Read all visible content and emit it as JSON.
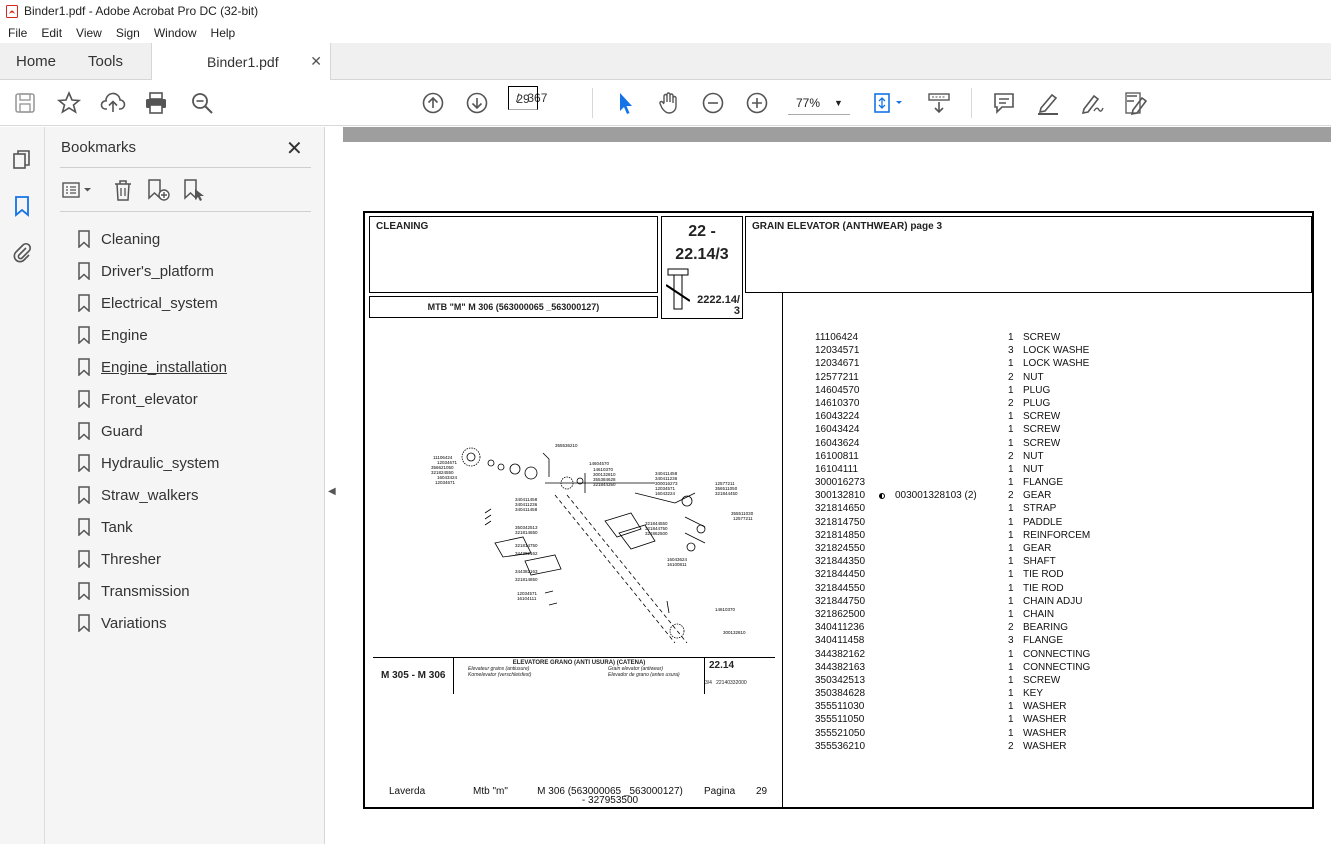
{
  "window": {
    "title": "Binder1.pdf - Adobe Acrobat Pro DC (32-bit)"
  },
  "menu": [
    "File",
    "Edit",
    "View",
    "Sign",
    "Window",
    "Help"
  ],
  "tabs": {
    "home": "Home",
    "tools": "Tools",
    "document": "Binder1.pdf"
  },
  "toolbar": {
    "current_page": "29",
    "page_sep": "/",
    "total_pages": "367",
    "zoom": "77%"
  },
  "bookmarks": {
    "title": "Bookmarks",
    "items": [
      "Cleaning",
      "Driver's_platform",
      "Electrical_system",
      "Engine",
      "Engine_installation",
      "Front_elevator",
      "Guard",
      "Hydraulic_system",
      "Straw_walkers",
      "Tank",
      "Thresher",
      "Transmission",
      "Variations"
    ]
  },
  "page": {
    "section": "CLEANING",
    "code_line1": "22 -",
    "code_line2": "22.14/3",
    "code_small": "2222.14/",
    "code_small2": "3",
    "title": "GRAIN ELEVATOR (ANTHWEAR) page 3",
    "model": "MTB \"M\" M 306 (563000065 _563000127)",
    "parts": [
      {
        "code": "11106424",
        "note": "",
        "qty": "1",
        "desc": "SCREW"
      },
      {
        "code": "12034571",
        "note": "",
        "qty": "3",
        "desc": "LOCK WASHE"
      },
      {
        "code": "12034671",
        "note": "",
        "qty": "1",
        "desc": "LOCK WASHE"
      },
      {
        "code": "12577211",
        "note": "",
        "qty": "2",
        "desc": "NUT"
      },
      {
        "code": "14604570",
        "note": "",
        "qty": "1",
        "desc": "PLUG"
      },
      {
        "code": "14610370",
        "note": "",
        "qty": "2",
        "desc": "PLUG"
      },
      {
        "code": "16043224",
        "note": "",
        "qty": "1",
        "desc": "SCREW"
      },
      {
        "code": "16043424",
        "note": "",
        "qty": "1",
        "desc": "SCREW"
      },
      {
        "code": "16043624",
        "note": "",
        "qty": "1",
        "desc": "SCREW"
      },
      {
        "code": "16100811",
        "note": "",
        "qty": "2",
        "desc": "NUT"
      },
      {
        "code": "16104111",
        "note": "",
        "qty": "1",
        "desc": "NUT"
      },
      {
        "code": "300016273",
        "note": "",
        "qty": "1",
        "desc": "FLANGE"
      },
      {
        "code": "300132810",
        "note": "003001328103  (2)",
        "qty": "2",
        "desc": "GEAR"
      },
      {
        "code": "321814650",
        "note": "",
        "qty": "1",
        "desc": "STRAP"
      },
      {
        "code": "321814750",
        "note": "",
        "qty": "1",
        "desc": "PADDLE"
      },
      {
        "code": "321814850",
        "note": "",
        "qty": "1",
        "desc": "REINFORCEM"
      },
      {
        "code": "321824550",
        "note": "",
        "qty": "1",
        "desc": "GEAR"
      },
      {
        "code": "321844350",
        "note": "",
        "qty": "1",
        "desc": "SHAFT"
      },
      {
        "code": "321844450",
        "note": "",
        "qty": "1",
        "desc": "TIE ROD"
      },
      {
        "code": "321844550",
        "note": "",
        "qty": "1",
        "desc": "TIE ROD"
      },
      {
        "code": "321844750",
        "note": "",
        "qty": "1",
        "desc": "CHAIN ADJU"
      },
      {
        "code": "321862500",
        "note": "",
        "qty": "1",
        "desc": "CHAIN"
      },
      {
        "code": "340411236",
        "note": "",
        "qty": "2",
        "desc": "BEARING"
      },
      {
        "code": "340411458",
        "note": "",
        "qty": "3",
        "desc": "FLANGE"
      },
      {
        "code": "344382162",
        "note": "",
        "qty": "1",
        "desc": "CONNECTING"
      },
      {
        "code": "344382163",
        "note": "",
        "qty": "1",
        "desc": "CONNECTING"
      },
      {
        "code": "350342513",
        "note": "",
        "qty": "1",
        "desc": "SCREW"
      },
      {
        "code": "350384628",
        "note": "",
        "qty": "1",
        "desc": "KEY"
      },
      {
        "code": "355511030",
        "note": "",
        "qty": "1",
        "desc": "WASHER"
      },
      {
        "code": "355511050",
        "note": "",
        "qty": "1",
        "desc": "WASHER"
      },
      {
        "code": "355521050",
        "note": "",
        "qty": "1",
        "desc": "WASHER"
      },
      {
        "code": "355536210",
        "note": "",
        "qty": "2",
        "desc": "WASHER"
      }
    ],
    "legend": {
      "model": "M 305 - M 306",
      "title": "ELEVATORE GRANO (ANTI USURA) (CATENA)",
      "sub1": "Elevateur grains (antiusure)",
      "sub2": "Kornelevator (verschleisfest)",
      "sub3": "Grain elevator (antiwear)",
      "sub4": "Elevador de grano (antes usura)",
      "code": "22.14",
      "pg": "3/4",
      "ref": "22140332000"
    },
    "footer": {
      "brand": "Laverda",
      "line": "Mtb \"m\"",
      "model": "M 306 (563000065 _563000127)",
      "model2": "- 327953500",
      "pagina": "Pagina",
      "page_no": "29"
    }
  }
}
